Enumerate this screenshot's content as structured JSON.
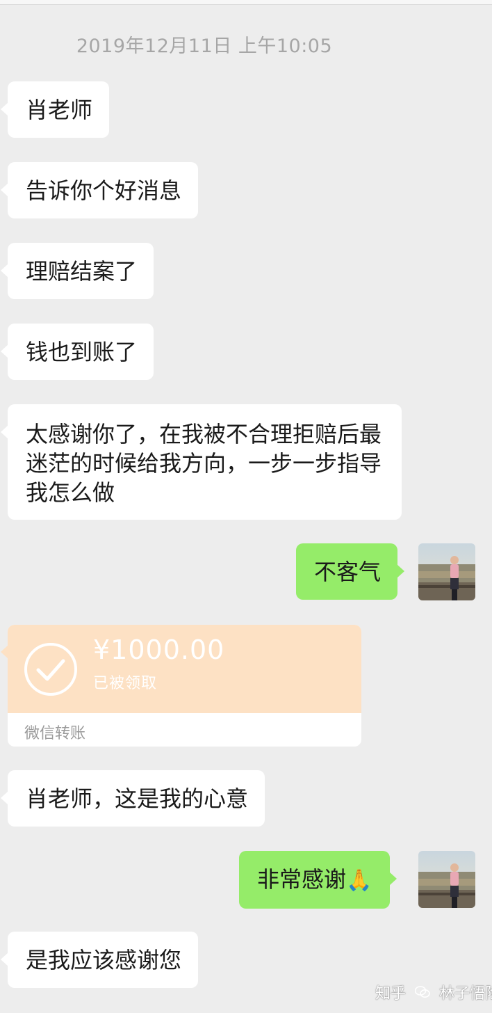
{
  "timestamp": "2019年12月11日 上午10:05",
  "messages": [
    {
      "text": "肖老师"
    },
    {
      "text": "告诉你个好消息"
    },
    {
      "text": "理赔结案了"
    },
    {
      "text": "钱也到账了"
    },
    {
      "text": "太感谢你了，在我被不合理拒赔后最迷茫的时候给我方向，一步一步指导我怎么做"
    },
    {
      "text": "不客气"
    },
    {
      "text": "肖老师，这是我的心意"
    },
    {
      "text": "非常感谢",
      "emoji": "🙏"
    },
    {
      "text": "是我应该感谢您"
    }
  ],
  "transfer": {
    "amount": "¥1000.00",
    "status": "已被领取",
    "label": "微信转账",
    "icon": "check-circle-icon"
  },
  "watermark": {
    "left": "知乎",
    "right": "林子悟险",
    "icon": "wechat-icon"
  },
  "colors": {
    "background": "#ededed",
    "incoming_bubble": "#ffffff",
    "outgoing_bubble": "#95ec69",
    "transfer_card": "#fde1c4"
  }
}
